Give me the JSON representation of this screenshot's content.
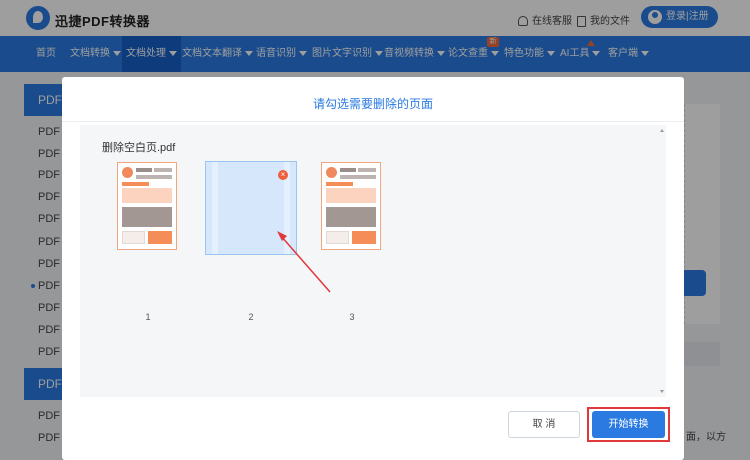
{
  "header": {
    "brand": "迅捷PDF转换器",
    "online_service": "在线客服",
    "my_files": "我的文件",
    "login_register": "登录|注册"
  },
  "nav": {
    "items": [
      {
        "label": "首页"
      },
      {
        "label": "文档转换"
      },
      {
        "label": "文档处理"
      },
      {
        "label": "文档文本翻译"
      },
      {
        "label": "语音识别"
      },
      {
        "label": "图片文字识别"
      },
      {
        "label": "音视频转换"
      },
      {
        "label": "论文查重"
      },
      {
        "label": "特色功能"
      },
      {
        "label": "AI工具"
      },
      {
        "label": "客户端"
      }
    ],
    "new_badge": "新"
  },
  "background": {
    "sidebar_heads": [
      "PDF",
      "PDF"
    ],
    "sidebar_items": [
      "PDF",
      "PDF",
      "PDF",
      "PDF",
      "PDF",
      "PDF",
      "PDF",
      "PDF",
      "PDF",
      "PDF",
      "PDF",
      "PDF",
      "PDF"
    ],
    "right_fragment": "面，以方"
  },
  "modal": {
    "title": "请勾选需要删除的页面",
    "file_name": "删除空白页.pdf",
    "pages": [
      {
        "number": "1",
        "blank": false
      },
      {
        "number": "2",
        "blank": true
      },
      {
        "number": "3",
        "blank": false
      }
    ],
    "delete_icon": "x-circle-icon",
    "cancel_label": "取 消",
    "start_label": "开始转换"
  },
  "colors": {
    "accent": "#2a7ae2",
    "nav_active": "#1560c8",
    "highlight_frame": "#e0383b",
    "annotation_arrow": "#e0383b",
    "delete_badge": "#ef5f3c"
  }
}
